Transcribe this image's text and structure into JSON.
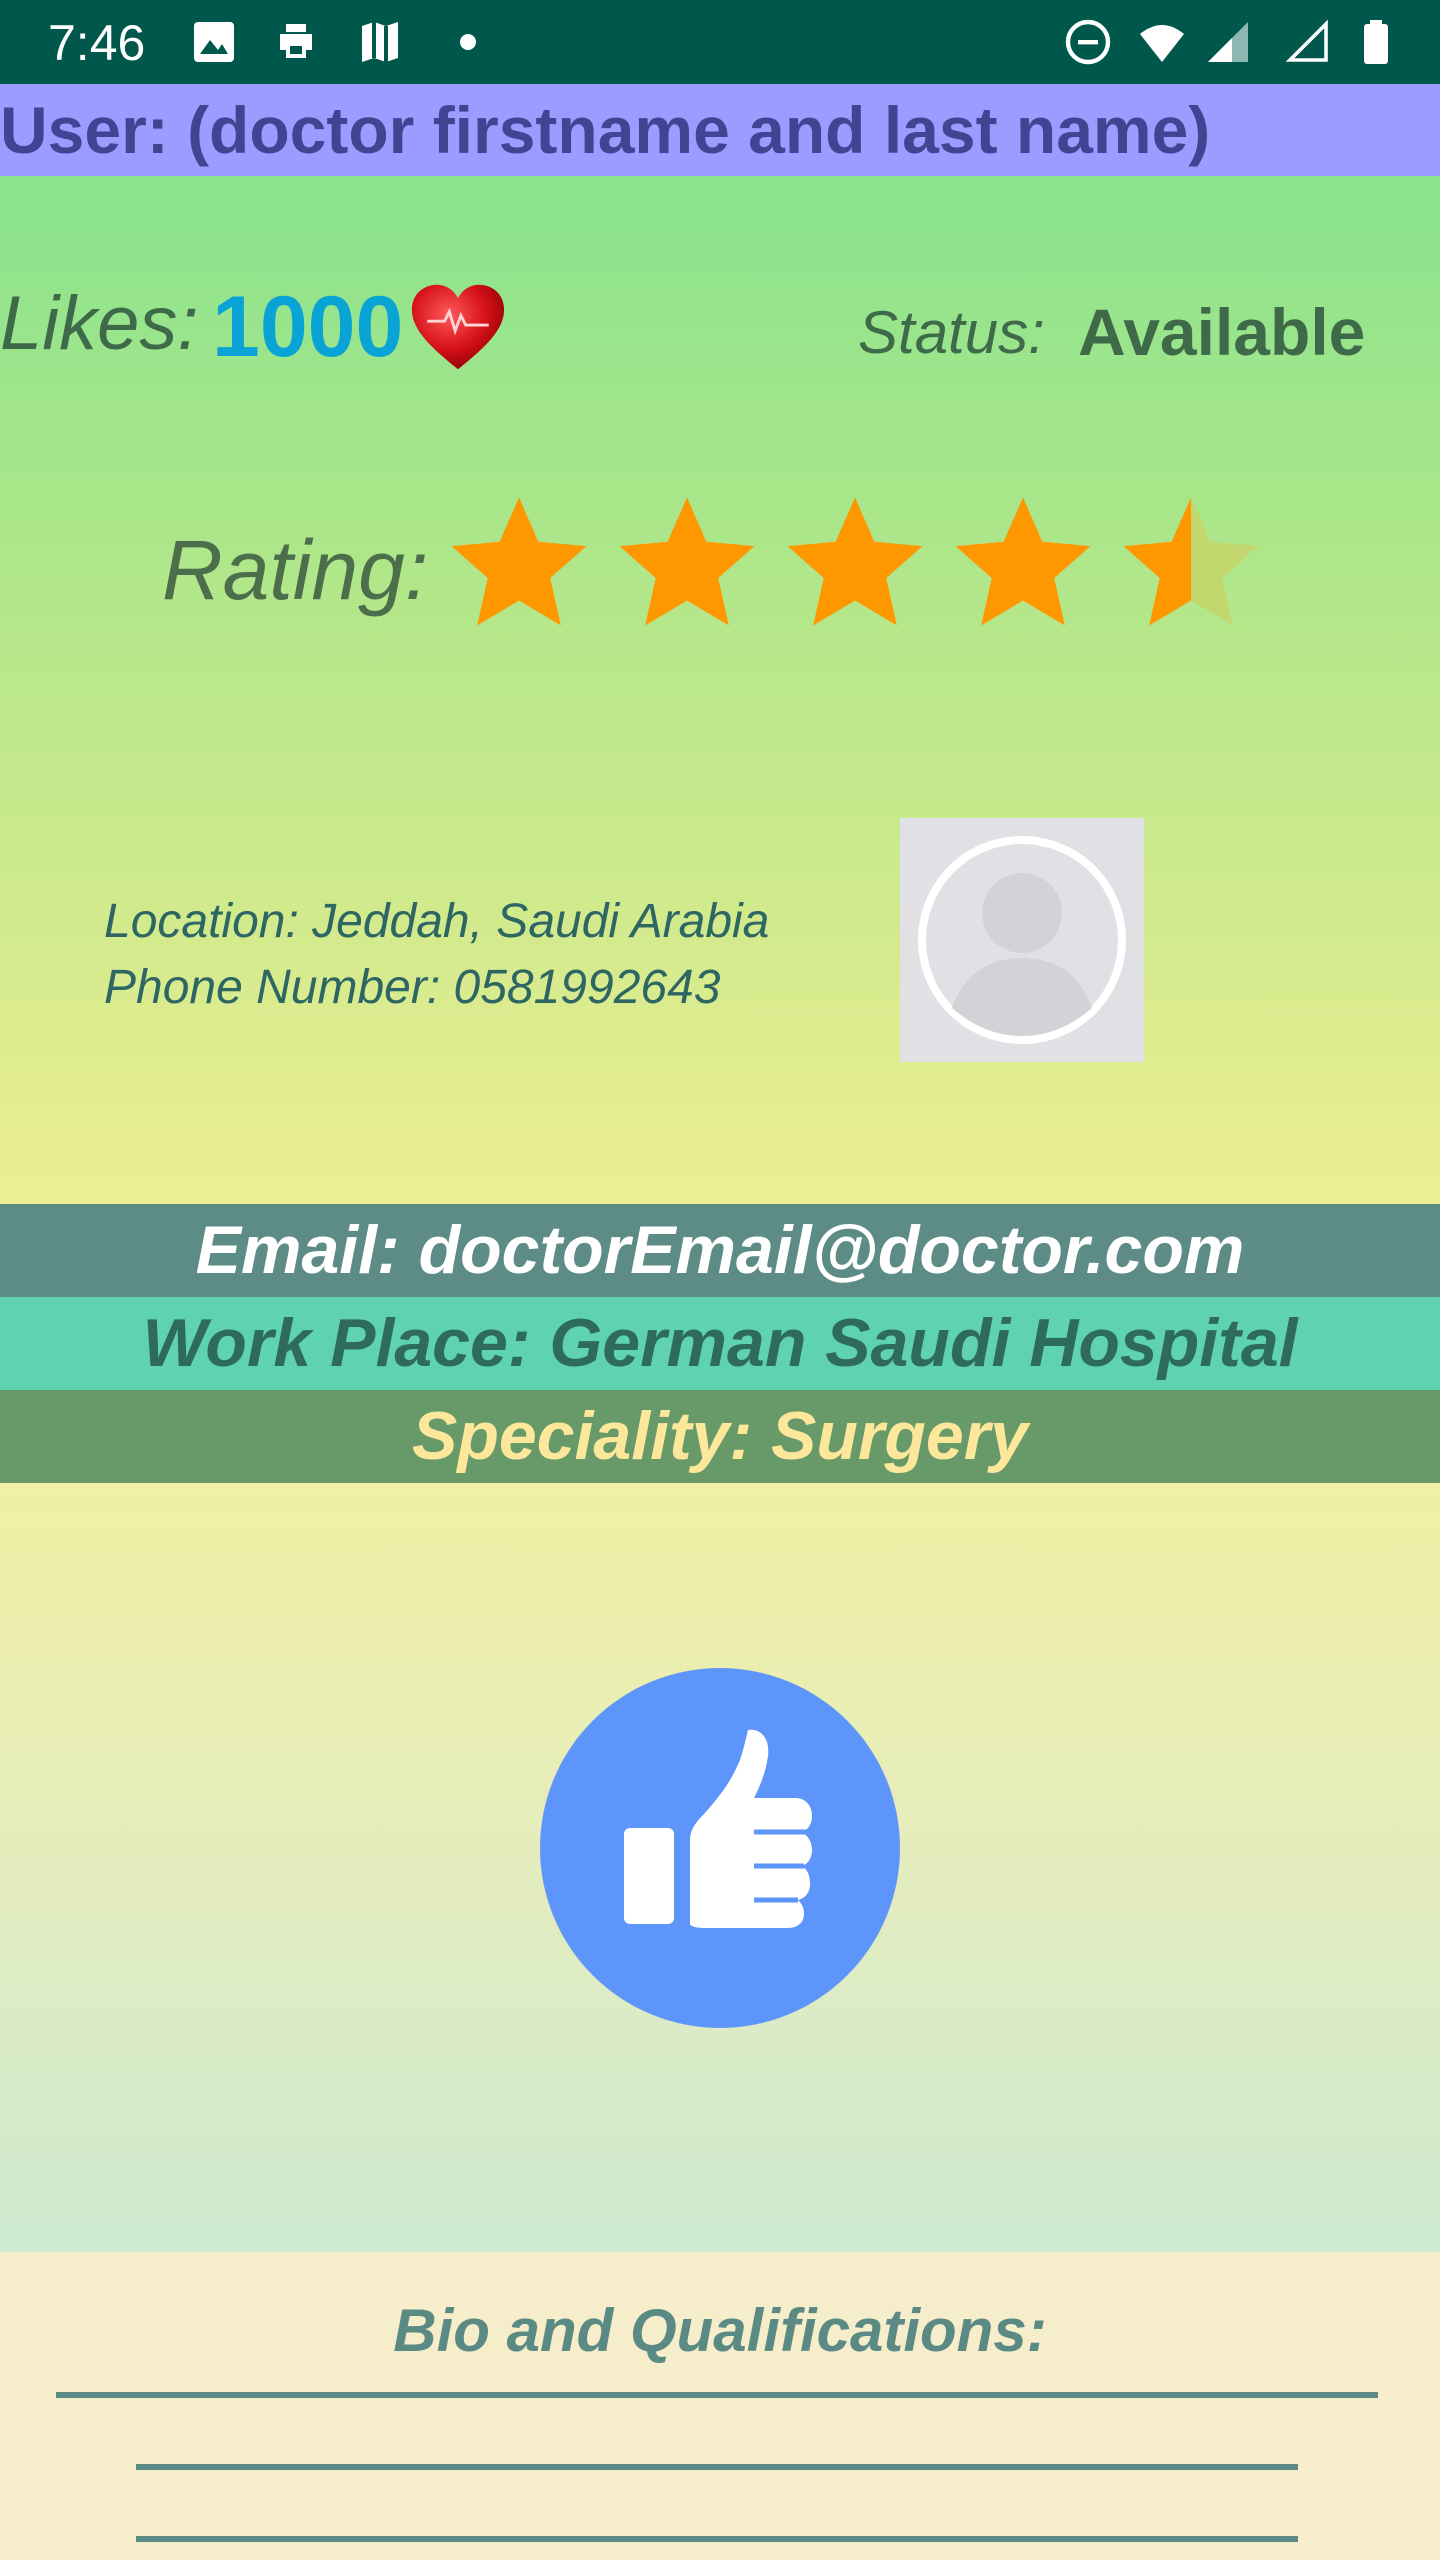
{
  "status_bar": {
    "time": "7:46",
    "left_icons": [
      "image-icon",
      "print-icon",
      "maps-icon",
      "dot-icon"
    ],
    "right_icons": [
      "do-not-disturb-icon",
      "wifi-icon",
      "signal-icon",
      "signal-empty-icon",
      "battery-icon"
    ]
  },
  "header": {
    "user_title": "User: (doctor firstname and last name)"
  },
  "stats": {
    "likes_label": "Likes:",
    "likes_value": "1000",
    "status_label": "Status:",
    "status_value": "Available"
  },
  "rating": {
    "label": "Rating:",
    "value": 4.5,
    "max": 5,
    "star_color": "#ff9800"
  },
  "contact": {
    "location": "Location: Jeddah, Saudi Arabia",
    "phone": "Phone Number: 0581992643"
  },
  "info_bands": {
    "email": "Email: doctorEmail@doctor.com",
    "work_place": "Work Place: German Saudi Hospital",
    "speciality": "Speciality: Surgery"
  },
  "bio": {
    "title": "Bio and Qualifications:"
  },
  "colors": {
    "status_bar": "#00574b",
    "user_bar": "#9a9cff",
    "email_band": "#5d8c86",
    "work_band": "#5fd3b0",
    "speciality_band": "#689a69",
    "like_button": "#5e95fb",
    "likes_number": "#0aa3d6"
  }
}
